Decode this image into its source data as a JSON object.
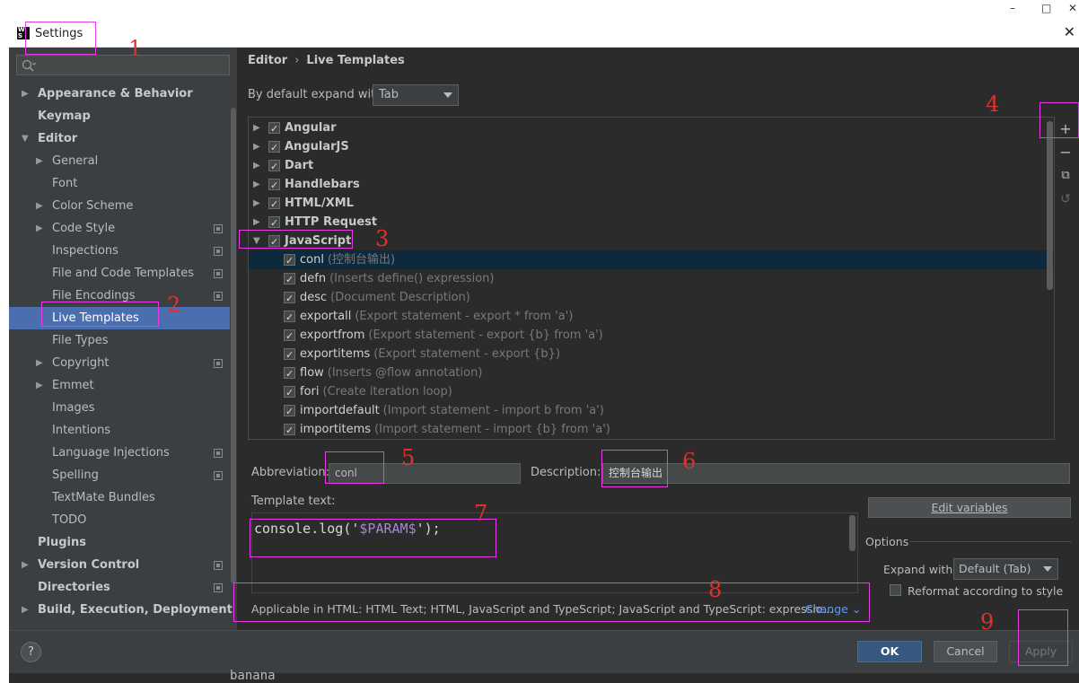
{
  "window": {
    "title": "Settings",
    "minimize_glyph": "–",
    "maximize_glyph": "□",
    "close_glyph": "✕",
    "logo_text": [
      "W",
      "S"
    ]
  },
  "sidebar": {
    "search_placeholder": "",
    "items": [
      {
        "label": "Appearance & Behavior",
        "level": 0,
        "expand": "collapsed",
        "bold": true,
        "cfg": false
      },
      {
        "label": "Keymap",
        "level": 0,
        "expand": "none",
        "bold": true,
        "cfg": false
      },
      {
        "label": "Editor",
        "level": 0,
        "expand": "expanded",
        "bold": true,
        "cfg": false
      },
      {
        "label": "General",
        "level": 1,
        "expand": "collapsed",
        "bold": false,
        "cfg": false
      },
      {
        "label": "Font",
        "level": 1,
        "expand": "none",
        "bold": false,
        "cfg": false
      },
      {
        "label": "Color Scheme",
        "level": 1,
        "expand": "collapsed",
        "bold": false,
        "cfg": false
      },
      {
        "label": "Code Style",
        "level": 1,
        "expand": "collapsed",
        "bold": false,
        "cfg": true
      },
      {
        "label": "Inspections",
        "level": 1,
        "expand": "none",
        "bold": false,
        "cfg": true
      },
      {
        "label": "File and Code Templates",
        "level": 1,
        "expand": "none",
        "bold": false,
        "cfg": true
      },
      {
        "label": "File Encodings",
        "level": 1,
        "expand": "none",
        "bold": false,
        "cfg": true
      },
      {
        "label": "Live Templates",
        "level": 1,
        "expand": "none",
        "bold": false,
        "cfg": false,
        "selected": true
      },
      {
        "label": "File Types",
        "level": 1,
        "expand": "none",
        "bold": false,
        "cfg": false
      },
      {
        "label": "Copyright",
        "level": 1,
        "expand": "collapsed",
        "bold": false,
        "cfg": true
      },
      {
        "label": "Emmet",
        "level": 1,
        "expand": "collapsed",
        "bold": false,
        "cfg": false
      },
      {
        "label": "Images",
        "level": 1,
        "expand": "none",
        "bold": false,
        "cfg": false
      },
      {
        "label": "Intentions",
        "level": 1,
        "expand": "none",
        "bold": false,
        "cfg": false
      },
      {
        "label": "Language Injections",
        "level": 1,
        "expand": "none",
        "bold": false,
        "cfg": true
      },
      {
        "label": "Spelling",
        "level": 1,
        "expand": "none",
        "bold": false,
        "cfg": true
      },
      {
        "label": "TextMate Bundles",
        "level": 1,
        "expand": "none",
        "bold": false,
        "cfg": false
      },
      {
        "label": "TODO",
        "level": 1,
        "expand": "none",
        "bold": false,
        "cfg": false
      },
      {
        "label": "Plugins",
        "level": 0,
        "expand": "none",
        "bold": true,
        "cfg": false
      },
      {
        "label": "Version Control",
        "level": 0,
        "expand": "collapsed",
        "bold": true,
        "cfg": true
      },
      {
        "label": "Directories",
        "level": 0,
        "expand": "none",
        "bold": true,
        "cfg": true
      },
      {
        "label": "Build, Execution, Deployment",
        "level": 0,
        "expand": "collapsed",
        "bold": true,
        "cfg": false
      }
    ]
  },
  "breadcrumb": {
    "parent": "Editor",
    "sep": "›",
    "current": "Live Templates"
  },
  "expand_default": {
    "label": "By default expand with",
    "value": "Tab"
  },
  "template_groups": [
    {
      "name": "Angular",
      "expanded": false,
      "checked": true
    },
    {
      "name": "AngularJS",
      "expanded": false,
      "checked": true
    },
    {
      "name": "Dart",
      "expanded": false,
      "checked": true
    },
    {
      "name": "Handlebars",
      "expanded": false,
      "checked": true
    },
    {
      "name": "HTML/XML",
      "expanded": false,
      "checked": true
    },
    {
      "name": "HTTP Request",
      "expanded": false,
      "checked": true
    },
    {
      "name": "JavaScript",
      "expanded": true,
      "checked": true
    }
  ],
  "templates": [
    {
      "abbr": "conl",
      "desc": "(控制台输出)",
      "selected": true
    },
    {
      "abbr": "defn",
      "desc": "(Inserts define() expression)"
    },
    {
      "abbr": "desc",
      "desc": "(Document Description)"
    },
    {
      "abbr": "exportall",
      "desc": "(Export statement - export * from 'a')"
    },
    {
      "abbr": "exportfrom",
      "desc": "(Export statement - export {b} from 'a')"
    },
    {
      "abbr": "exportitems",
      "desc": "(Export statement - export {b})"
    },
    {
      "abbr": "flow",
      "desc": "(Inserts @flow annotation)"
    },
    {
      "abbr": "fori",
      "desc": "(Create iteration loop)"
    },
    {
      "abbr": "importdefault",
      "desc": "(Import statement - import b from 'a')"
    },
    {
      "abbr": "importitems",
      "desc": "(Import statement - import {b} from 'a')"
    }
  ],
  "toolbar": {
    "add": "+",
    "remove": "−",
    "copy": "⧉",
    "restore": "↺"
  },
  "fields": {
    "abbreviation_label": "Abbreviation:",
    "abbreviation_value": "conl",
    "description_label": "Description:",
    "description_value": "控制台输出",
    "template_text_label": "Template text:",
    "template_code_pre": "console.log('",
    "template_code_var": "$PARAM$",
    "template_code_post": "');"
  },
  "applicable": {
    "text": "Applicable in HTML: HTML Text; HTML, JavaScript and TypeScript; JavaScript and TypeScript: expressio...",
    "change": "Change ⌄"
  },
  "options": {
    "edit_variables": "Edit variables",
    "title": "Options",
    "expand_with_label": "Expand with",
    "expand_with_value": "Default (Tab)",
    "reformat_label": "Reformat according to style"
  },
  "buttons": {
    "help": "?",
    "ok": "OK",
    "cancel": "Cancel",
    "apply": "Apply"
  },
  "underlying": {
    "text": "banana"
  },
  "annotations": [
    "1",
    "2",
    "3",
    "4",
    "5",
    "6",
    "7",
    "8",
    "9"
  ],
  "colors": {
    "selection": "#4b6eaf",
    "accent_link": "#589df6",
    "annotation_box": "#e83be8",
    "annotation_number": "#e0322c"
  }
}
